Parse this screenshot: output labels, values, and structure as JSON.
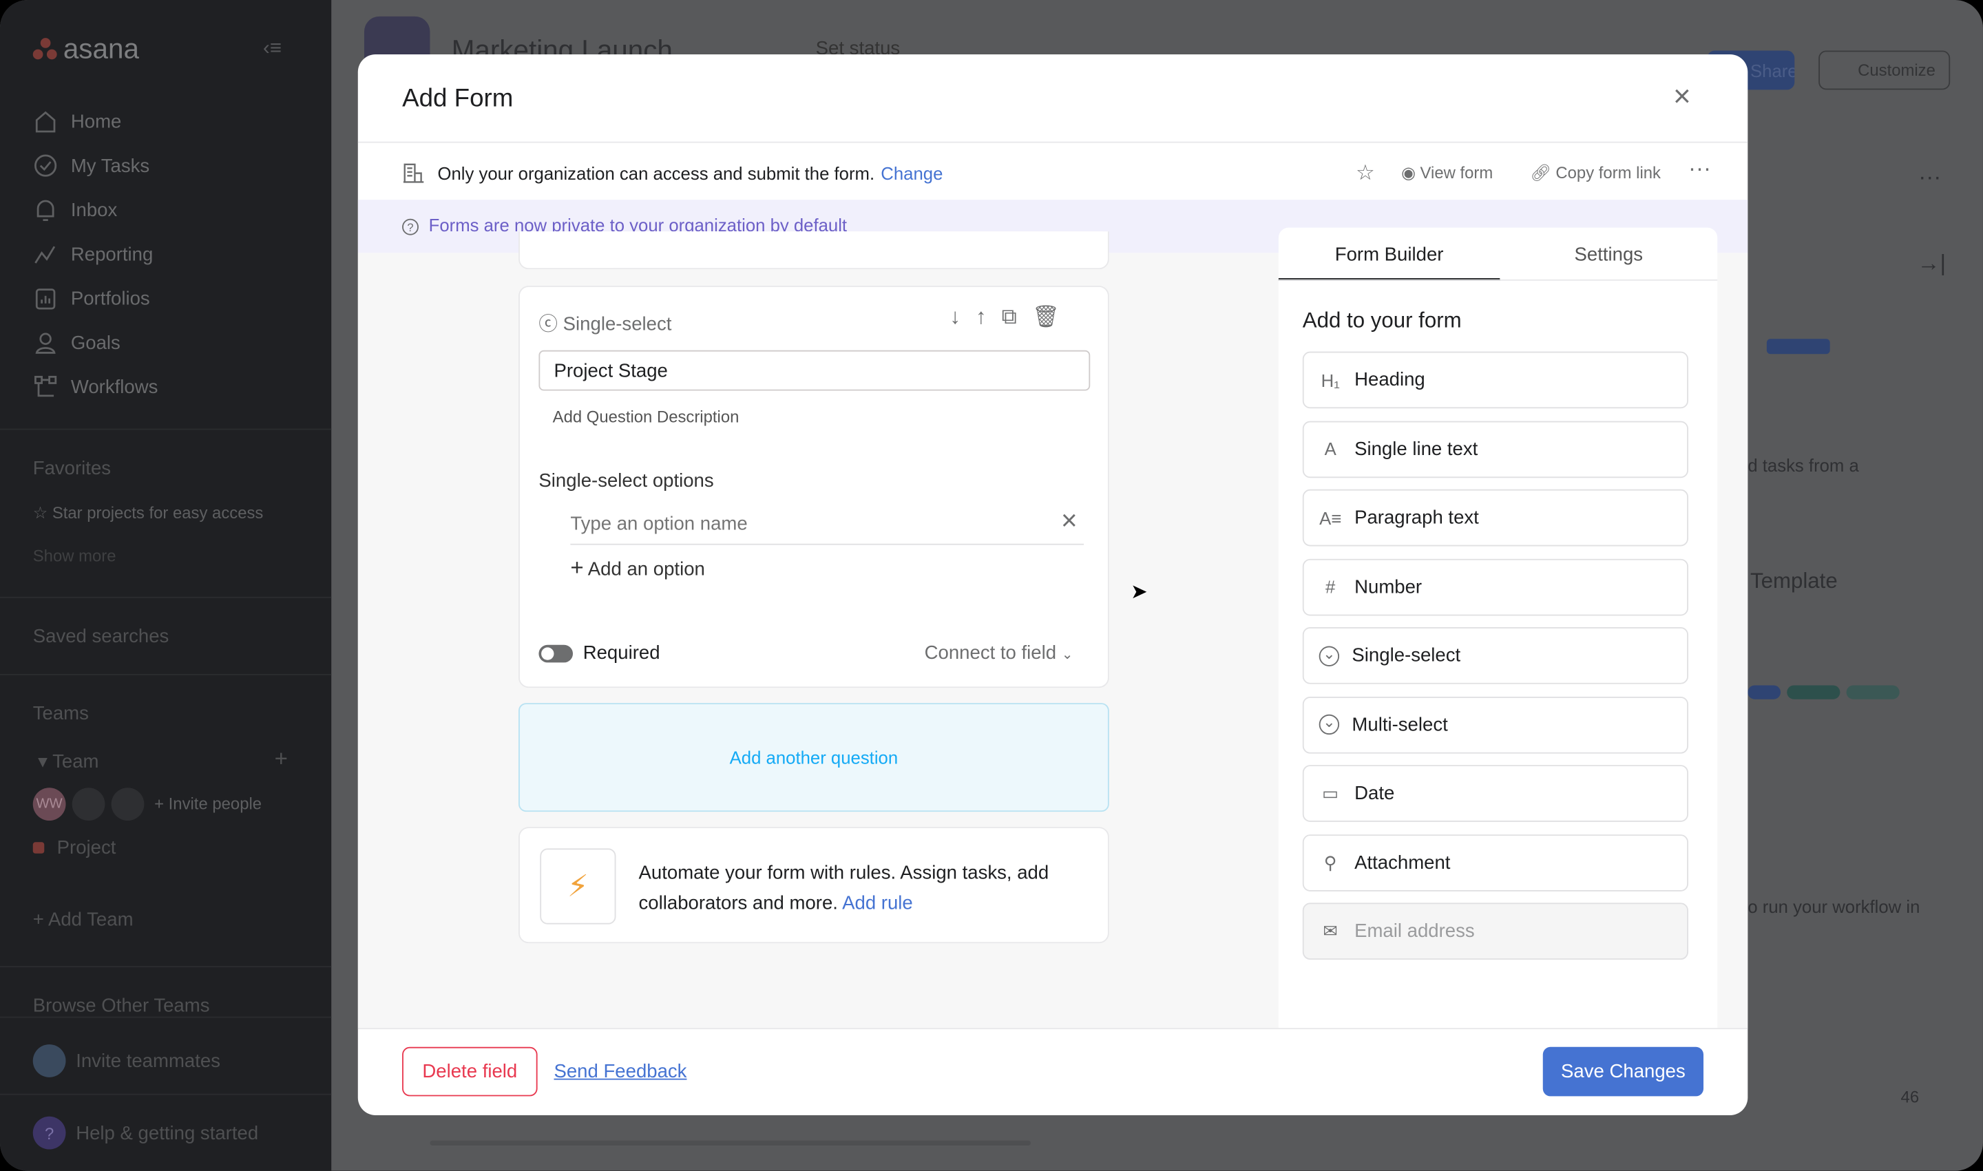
{
  "sidebar": {
    "brand": "asana",
    "items": [
      {
        "label": "Home",
        "icon": "home-icon"
      },
      {
        "label": "My Tasks",
        "icon": "check-circle-icon"
      },
      {
        "label": "Inbox",
        "icon": "bell-icon"
      },
      {
        "label": "Reporting",
        "icon": "chart-line-icon"
      },
      {
        "label": "Portfolios",
        "icon": "folder-chart-icon"
      },
      {
        "label": "Goals",
        "icon": "person-icon"
      },
      {
        "label": "Workflows",
        "icon": "workflow-icon"
      }
    ],
    "favorites": "Favorites",
    "star_hint": "Star projects for easy access",
    "show_more": "Show more",
    "saved_searches": "Saved searches",
    "teams": "Teams",
    "team": "Team",
    "avatar_initials": "WW",
    "invite_people": "+ Invite people",
    "project": "Project",
    "add_team": "+ Add Team",
    "browse": "Browse Other Teams",
    "invite_teammates": "Invite teammates",
    "help": "Help & getting started"
  },
  "background": {
    "project_title": "Marketing Launch",
    "set_status": "Set status",
    "share": "Share",
    "customize": "Customize",
    "text1": "d tasks from a",
    "template": "Template",
    "text2": "o run your workflow in",
    "count": "46"
  },
  "modal": {
    "title": "Add Form",
    "access_text": "Only your organization can access and submit the form.",
    "change": "Change",
    "view_form": "View form",
    "copy_link": "Copy form link",
    "banner": "Forms are now private to your organization by default",
    "question": {
      "type": "Single-select",
      "value": "Project Stage",
      "add_description": "Add Question Description",
      "options_label": "Single-select options",
      "option_placeholder": "Type an option name",
      "add_option": "Add an option",
      "required": "Required",
      "required_on": false,
      "connect": "Connect to field"
    },
    "add_another": "Add another question",
    "automate_text": "Automate your form with rules. Assign tasks, add collaborators and more.",
    "add_rule": "Add rule",
    "tabs": [
      "Form Builder",
      "Settings"
    ],
    "active_tab": "Form Builder",
    "add_heading": "Add to your form",
    "builder_items": [
      {
        "label": "Heading",
        "icon": "heading-icon"
      },
      {
        "label": "Single line text",
        "icon": "text-icon"
      },
      {
        "label": "Paragraph text",
        "icon": "paragraph-icon"
      },
      {
        "label": "Number",
        "icon": "hash-icon"
      },
      {
        "label": "Single-select",
        "icon": "chevron-circle-icon"
      },
      {
        "label": "Multi-select",
        "icon": "chevron-circle-icon"
      },
      {
        "label": "Date",
        "icon": "calendar-icon"
      },
      {
        "label": "Attachment",
        "icon": "paperclip-icon"
      },
      {
        "label": "Email address",
        "icon": "mail-icon",
        "disabled": true
      }
    ],
    "delete_field": "Delete field",
    "send_feedback": "Send Feedback",
    "save": "Save Changes"
  },
  "colors": {
    "accent": "#4573d2",
    "danger": "#e8384f",
    "banner_text": "#6c5fc7",
    "bolt": "#f1a33c"
  }
}
